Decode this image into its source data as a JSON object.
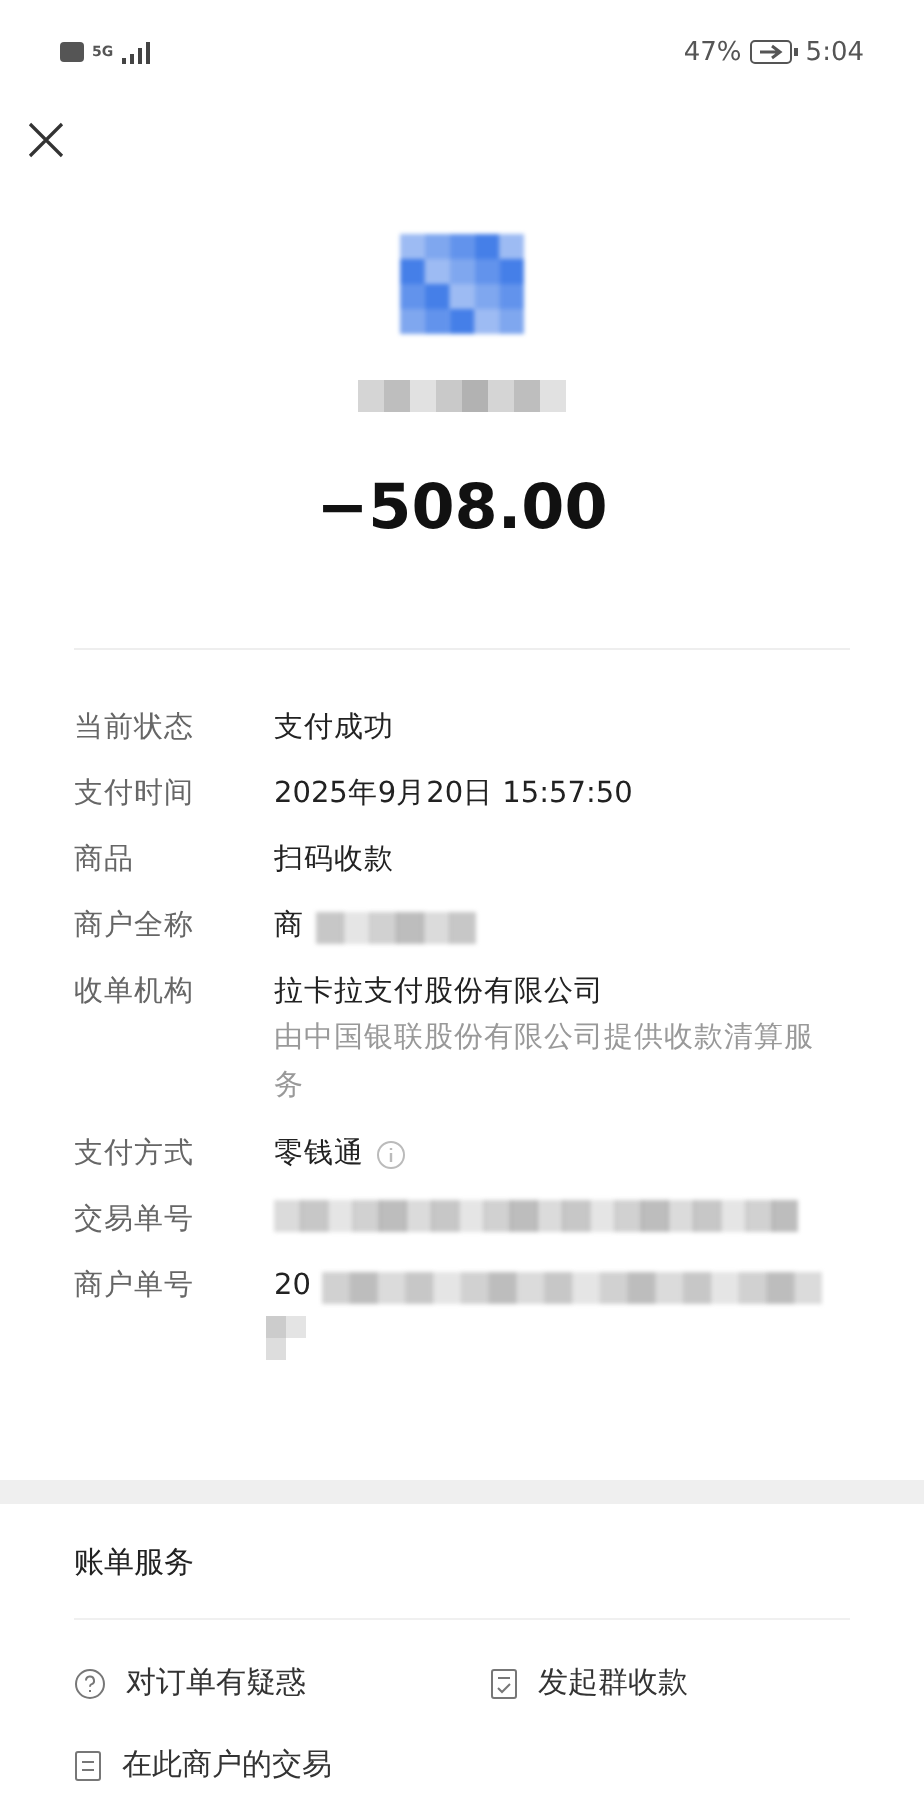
{
  "status_bar": {
    "network": "5G",
    "battery": "47%",
    "time": "5:04",
    "charging": true
  },
  "amount": "−508.00",
  "details": [
    {
      "label": "当前状态",
      "value": "支付成功"
    },
    {
      "label": "支付时间",
      "value": "2025年9月20日 15:57:50"
    },
    {
      "label": "商品",
      "value": "扫码收款"
    },
    {
      "label": "商户全称",
      "value": "商",
      "redacted": true
    },
    {
      "label": "收单机构",
      "value": "拉卡拉支付股份有限公司",
      "note": "由中国银联股份有限公司提供收款清算服务"
    },
    {
      "label": "支付方式",
      "value": "零钱通",
      "info": true
    },
    {
      "label": "交易单号",
      "redacted": true
    },
    {
      "label": "商户单号",
      "value": "20",
      "redacted": true,
      "wrap": true
    }
  ],
  "services": {
    "title": "账单服务",
    "links": [
      {
        "kind": "question",
        "label": "对订单有疑惑"
      },
      {
        "kind": "split",
        "label": "发起群收款"
      },
      {
        "kind": "list",
        "label": "在此商户的交易"
      }
    ]
  }
}
